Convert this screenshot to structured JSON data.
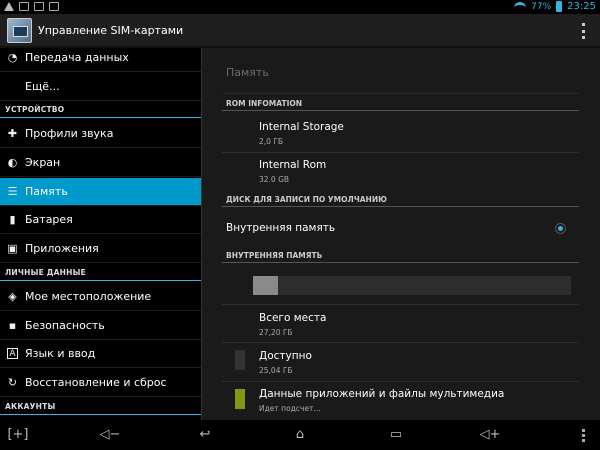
{
  "status_bar": {
    "battery": "77%",
    "time": "23:25",
    "icons": [
      "warning-icon",
      "image-icon",
      "mail-icon",
      "download-icon"
    ]
  },
  "action_bar": {
    "title": "Управление SIM-картами"
  },
  "sidebar": {
    "items_top": [
      {
        "label": "Передача данных",
        "icon": "data-usage-icon"
      },
      {
        "label": "Ещё...",
        "icon": ""
      }
    ],
    "section_device": "УСТРОЙСТВО",
    "items_device": [
      {
        "label": "Профили звука",
        "icon": "sound-profiles-icon"
      },
      {
        "label": "Экран",
        "icon": "display-icon"
      },
      {
        "label": "Память",
        "icon": "storage-icon",
        "active": true
      },
      {
        "label": "Батарея",
        "icon": "battery-icon"
      },
      {
        "label": "Приложения",
        "icon": "apps-icon"
      }
    ],
    "section_personal": "ЛИЧНЫЕ ДАННЫЕ",
    "items_personal": [
      {
        "label": "Мое местоположение",
        "icon": "location-icon"
      },
      {
        "label": "Безопасность",
        "icon": "lock-icon"
      },
      {
        "label": "Язык и ввод",
        "icon": "language-icon"
      },
      {
        "label": "Восстановление и сброс",
        "icon": "restore-icon"
      }
    ],
    "section_accounts": "АККАУНТЫ"
  },
  "main": {
    "page_title": "Память",
    "rom_header": "ROM INFOMATION",
    "internal_storage": {
      "title": "Internal Storage",
      "value": "2,0 ГБ"
    },
    "internal_rom": {
      "title": "Internal Rom",
      "value": "32.0 GB"
    },
    "default_disk_header": "ДИСК ДЛЯ ЗАПИСИ ПО УМОЛЧАНИЮ",
    "default_disk_option": "Внутренняя память",
    "internal_memory_header": "ВНУТРЕННЯЯ ПАМЯТЬ",
    "usage_fraction": 0.08,
    "total": {
      "title": "Всего места",
      "value": "27,20 ГБ"
    },
    "available": {
      "title": "Доступно",
      "value": "25,04 ГБ",
      "color": "#333333"
    },
    "app_data": {
      "title": "Данные приложений и файлы мультимедиа",
      "value": "Идет подсчет...",
      "color": "#7f9a17"
    }
  },
  "nav_bar": {
    "icons": [
      "screenshot-icon",
      "volume-down-icon",
      "back-icon",
      "home-icon",
      "recent-apps-icon",
      "volume-up-icon",
      "menu-icon"
    ]
  }
}
